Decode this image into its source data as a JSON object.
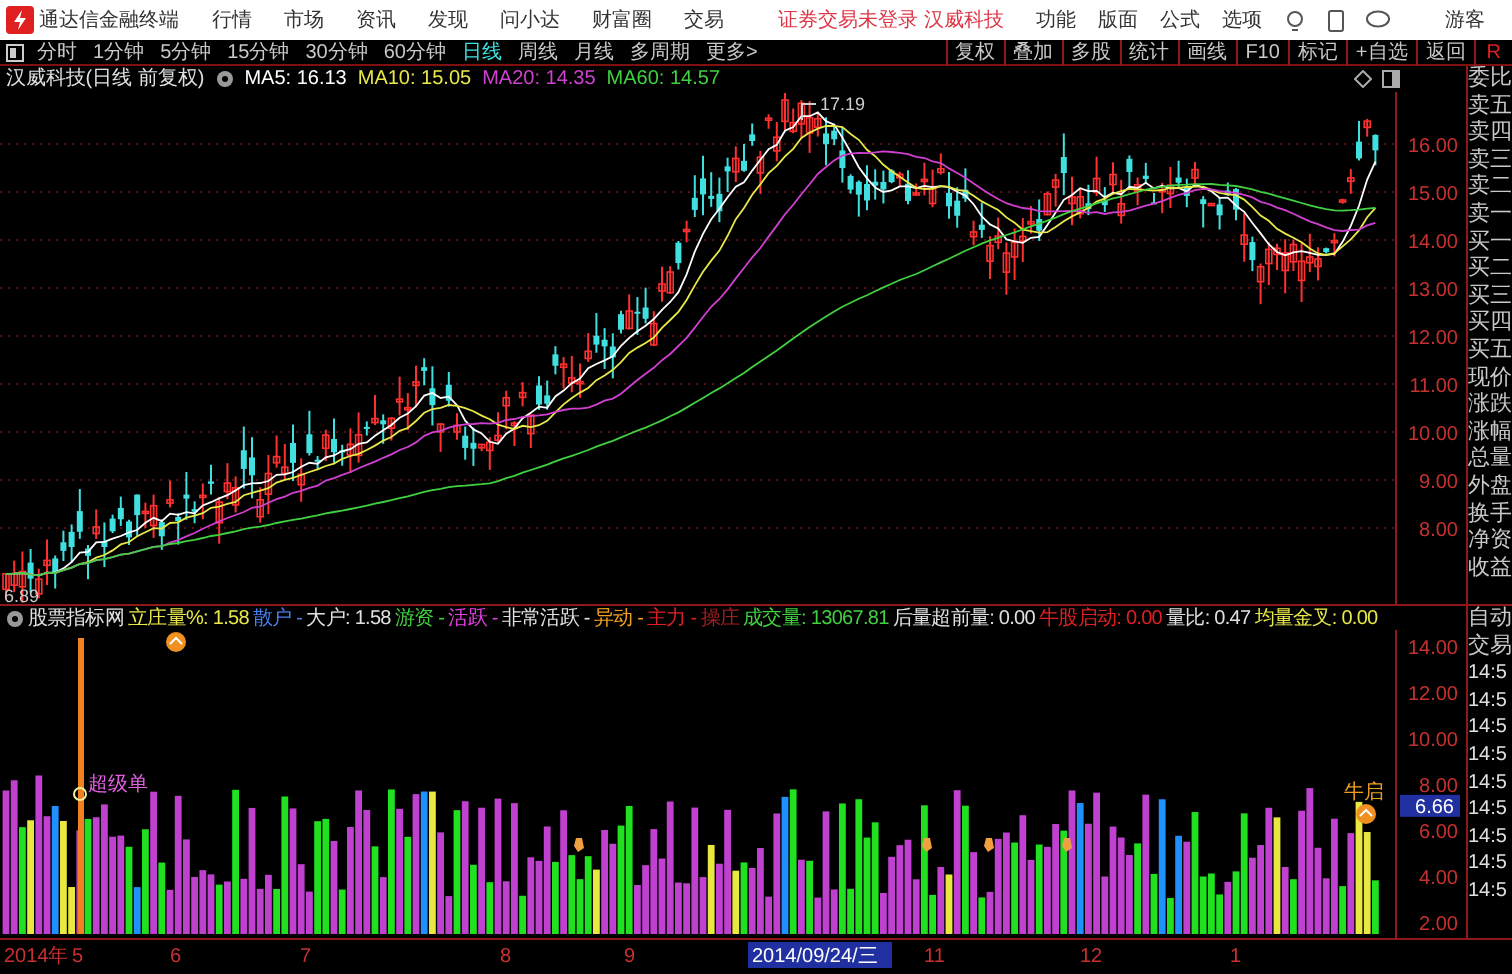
{
  "app": {
    "title": "通达信金融终端",
    "menus": [
      "行情",
      "市场",
      "资讯",
      "发现",
      "问小达",
      "财富圈",
      "交易"
    ],
    "notice": "证券交易未登录 汉威科技",
    "right_menus": [
      "功能",
      "版面",
      "公式",
      "选项"
    ],
    "user": "游客"
  },
  "periods": [
    {
      "label": "分时",
      "selected": false
    },
    {
      "label": "1分钟",
      "selected": false
    },
    {
      "label": "5分钟",
      "selected": false
    },
    {
      "label": "15分钟",
      "selected": false
    },
    {
      "label": "30分钟",
      "selected": false
    },
    {
      "label": "60分钟",
      "selected": false
    },
    {
      "label": "日线",
      "selected": true
    },
    {
      "label": "周线",
      "selected": false
    },
    {
      "label": "月线",
      "selected": false
    },
    {
      "label": "多周期",
      "selected": false
    },
    {
      "label": "更多>",
      "selected": false
    }
  ],
  "tools": [
    "复权",
    "叠加",
    "多股",
    "统计",
    "画线",
    "F10",
    "标记",
    "+自选",
    "返回"
  ],
  "tool_end": "R",
  "main_chart": {
    "title": "汉威科技(日线 前复权)",
    "indicators": [
      {
        "text": "MA5: 16.13",
        "color": "#ffffff"
      },
      {
        "text": "MA10: 15.05",
        "color": "#e8e84a"
      },
      {
        "text": "MA20: 14.35",
        "color": "#d040d0"
      },
      {
        "text": "MA60: 14.57",
        "color": "#40d040"
      }
    ],
    "price_labels": [
      "16.00",
      "15.00",
      "14.00",
      "13.00",
      "12.00",
      "11.00",
      "10.00",
      "9.00",
      "8.00"
    ],
    "high_label": "17.19",
    "low_label": "6.89"
  },
  "quote_labels": [
    "委比",
    "卖五",
    "卖四",
    "卖三",
    "卖二",
    "卖一",
    "买一",
    "买二",
    "买三",
    "买四",
    "买五",
    "现价",
    "涨跌",
    "涨幅",
    "总量",
    "外盘",
    "换手",
    "净资",
    "收益"
  ],
  "lower_side": [
    "自动",
    "交易",
    "14:5",
    "14:5",
    "14:5",
    "14:5",
    "14:5",
    "14:5",
    "14:5",
    "14:5",
    "14:5"
  ],
  "indicator_panel": {
    "title": "股票指标网",
    "items": [
      {
        "text": "立庄量%: 1.58",
        "color": "#e8e84a"
      },
      {
        "text": "散户 -",
        "color": "#4a7ef0"
      },
      {
        "text": "大户: 1.58",
        "color": "#e0e0e0"
      },
      {
        "text": "游资 -",
        "color": "#40d040"
      },
      {
        "text": "活跃 -",
        "color": "#e040e0"
      },
      {
        "text": "非常活跃 -",
        "color": "#e0e0e0"
      },
      {
        "text": "异动 -",
        "color": "#f0a020"
      },
      {
        "text": "主力 -",
        "color": "#e02020"
      },
      {
        "text": "操庄",
        "color": "#a02020"
      },
      {
        "text": "成交量: 13067.81",
        "color": "#40d040"
      },
      {
        "text": "后量超前量: 0.00",
        "color": "#e0e0e0"
      },
      {
        "text": "牛股启动: 0.00",
        "color": "#e02020"
      },
      {
        "text": "量比: 0.47",
        "color": "#e0e0e0"
      },
      {
        "text": "均量金叉: 0.00",
        "color": "#e8e84a"
      }
    ],
    "value_labels": [
      "14.00",
      "12.00",
      "10.00",
      "8.00",
      "6.00",
      "4.00",
      "2.00"
    ],
    "current_value": "6.66",
    "signal_labels": [
      "超级单",
      "牛启"
    ]
  },
  "date_axis": [
    {
      "label": "2014年",
      "selected": false
    },
    {
      "label": "5",
      "selected": false
    },
    {
      "label": "6",
      "selected": false
    },
    {
      "label": "7",
      "selected": false
    },
    {
      "label": "8",
      "selected": false
    },
    {
      "label": "9",
      "selected": false
    },
    {
      "label": "2014/09/24/三",
      "selected": true
    },
    {
      "label": "11",
      "selected": false
    },
    {
      "label": "12",
      "selected": false
    },
    {
      "label": "1",
      "selected": false
    }
  ]
}
